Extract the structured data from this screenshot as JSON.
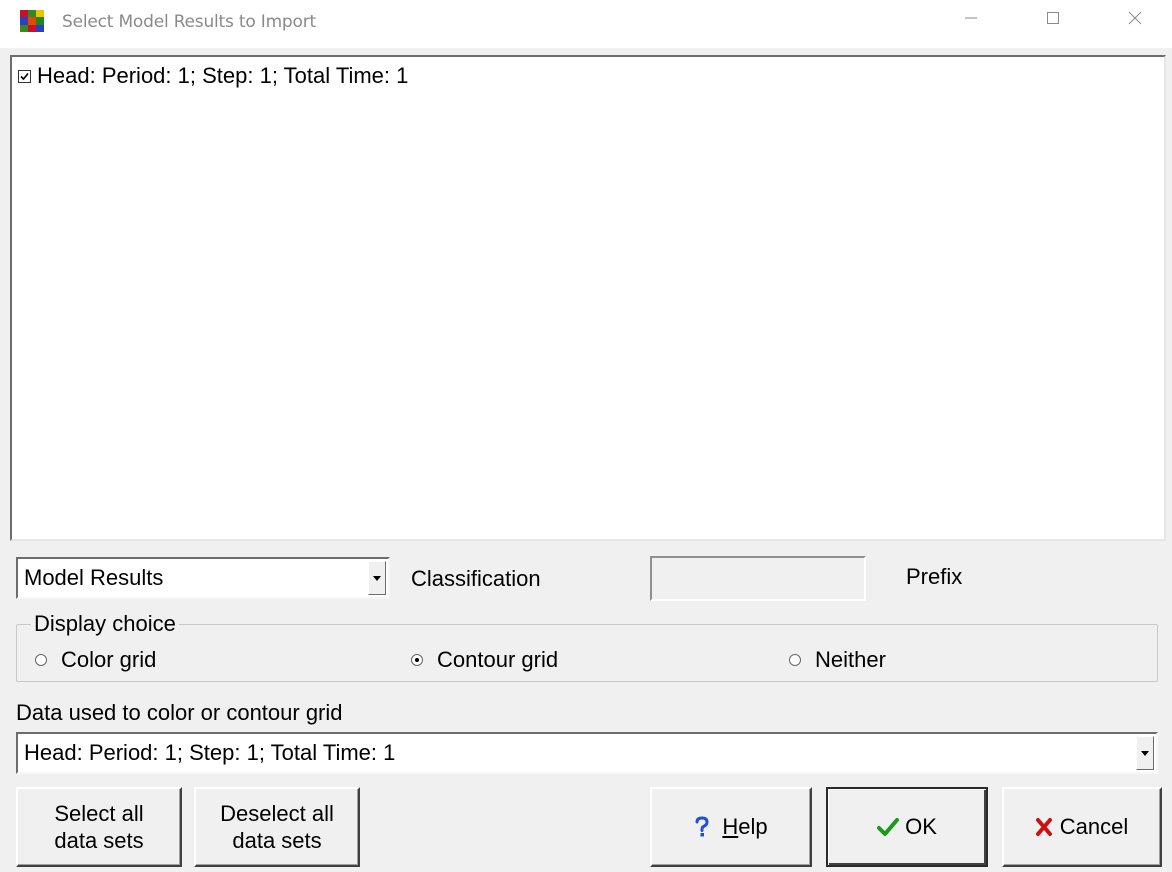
{
  "window": {
    "title": "Select Model Results to Import",
    "icon": "app-grid-icon",
    "controls": {
      "minimize": "minimize-icon",
      "maximize": "maximize-icon",
      "close": "close-icon"
    }
  },
  "list": {
    "items": [
      {
        "label": "Head: Period: 1; Step: 1; Total Time: 1",
        "checked": true
      }
    ]
  },
  "classification": {
    "selected": "Model Results",
    "label": "Classification"
  },
  "prefix": {
    "value": "",
    "label": "Prefix"
  },
  "display_choice": {
    "legend": "Display choice",
    "options": [
      {
        "label": "Color grid",
        "selected": false
      },
      {
        "label": "Contour grid",
        "selected": true
      },
      {
        "label": "Neither",
        "selected": false
      }
    ]
  },
  "data_used": {
    "label": "Data used to color or contour grid",
    "selected": "Head: Period: 1; Step: 1; Total Time: 1"
  },
  "buttons": {
    "select_all": {
      "line1": "Select all",
      "line2": "data sets"
    },
    "deselect_all": {
      "line1": "Deselect all",
      "line2": "data sets"
    },
    "help": {
      "label_first": "H",
      "label_rest": "elp",
      "icon": "question-icon",
      "icon_color": "#1f4fd8"
    },
    "ok": {
      "label": "OK",
      "icon": "checkmark-icon",
      "icon_color": "#1a9a1a"
    },
    "cancel": {
      "label": "Cancel",
      "icon": "x-icon",
      "icon_color": "#d01010"
    }
  }
}
